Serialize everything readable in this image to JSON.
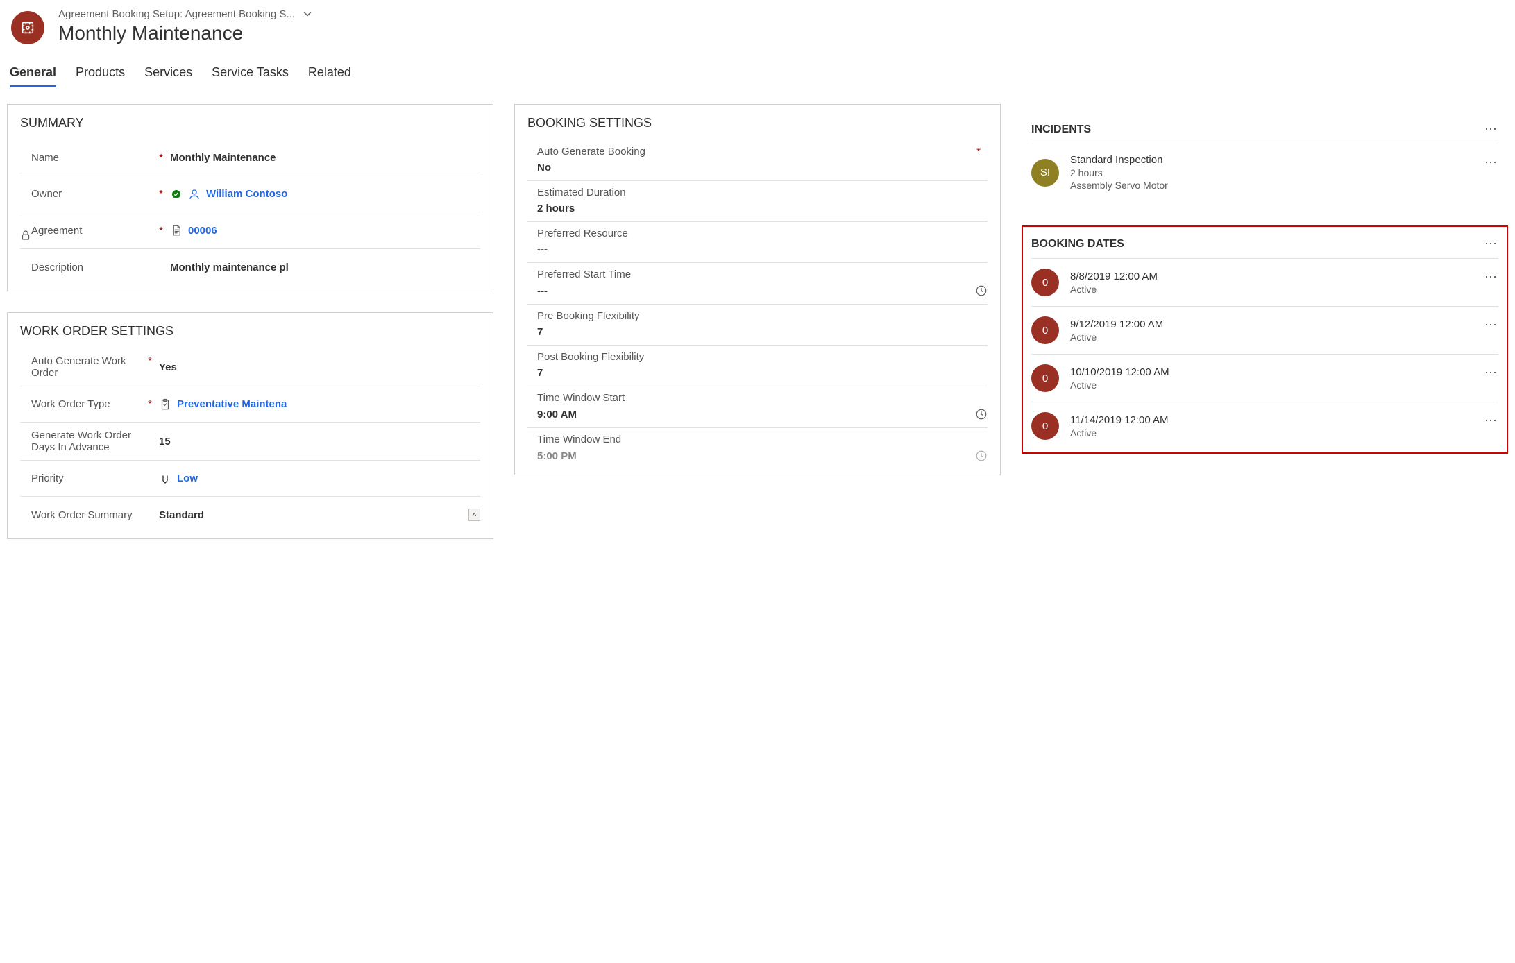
{
  "header": {
    "breadcrumb": "Agreement Booking Setup: Agreement Booking S...",
    "title": "Monthly Maintenance"
  },
  "tabs": [
    "General",
    "Products",
    "Services",
    "Service Tasks",
    "Related"
  ],
  "active_tab": 0,
  "summary": {
    "title": "SUMMARY",
    "name": {
      "label": "Name",
      "value": "Monthly Maintenance",
      "required": true
    },
    "owner": {
      "label": "Owner",
      "value": "William Contoso",
      "required": true
    },
    "agreement": {
      "label": "Agreement",
      "value": "00006",
      "required": true,
      "locked": true
    },
    "description": {
      "label": "Description",
      "value": "Monthly maintenance pl"
    }
  },
  "work_order_settings": {
    "title": "WORK ORDER SETTINGS",
    "auto_generate": {
      "label": "Auto Generate Work Order",
      "value": "Yes",
      "required": true
    },
    "type": {
      "label": "Work Order Type",
      "value": "Preventative Maintena",
      "required": true
    },
    "days_in_advance": {
      "label": "Generate Work Order Days In Advance",
      "value": "15"
    },
    "priority": {
      "label": "Priority",
      "value": "Low"
    },
    "summary": {
      "label": "Work Order Summary",
      "value": "Standard"
    }
  },
  "booking_settings": {
    "title": "BOOKING SETTINGS",
    "auto_generate": {
      "label": "Auto Generate Booking",
      "value": "No",
      "required": true
    },
    "estimated_duration": {
      "label": "Estimated Duration",
      "value": "2 hours"
    },
    "preferred_resource": {
      "label": "Preferred Resource",
      "value": "---"
    },
    "preferred_start_time": {
      "label": "Preferred Start Time",
      "value": "---"
    },
    "pre_flex": {
      "label": "Pre Booking Flexibility",
      "value": "7"
    },
    "post_flex": {
      "label": "Post Booking Flexibility",
      "value": "7"
    },
    "window_start": {
      "label": "Time Window Start",
      "value": "9:00 AM"
    },
    "window_end": {
      "label": "Time Window End",
      "value": "5:00 PM"
    }
  },
  "incidents": {
    "title": "INCIDENTS",
    "items": [
      {
        "initials": "SI",
        "line1": "Standard Inspection",
        "line2": "2 hours",
        "line3": "Assembly Servo Motor"
      }
    ]
  },
  "booking_dates": {
    "title": "BOOKING DATES",
    "items": [
      {
        "initial": "0",
        "line1": "8/8/2019 12:00 AM",
        "line2": "Active"
      },
      {
        "initial": "0",
        "line1": "9/12/2019 12:00 AM",
        "line2": "Active"
      },
      {
        "initial": "0",
        "line1": "10/10/2019 12:00 AM",
        "line2": "Active"
      },
      {
        "initial": "0",
        "line1": "11/14/2019 12:00 AM",
        "line2": "Active"
      }
    ]
  }
}
